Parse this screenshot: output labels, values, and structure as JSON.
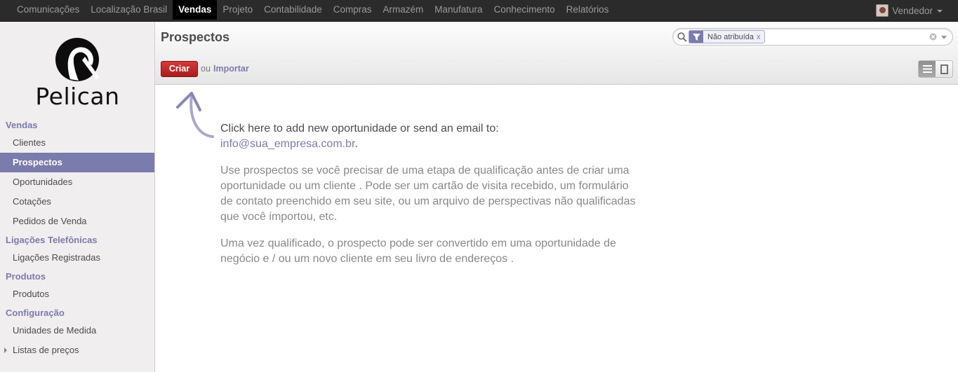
{
  "topmenu": [
    "Comunicações",
    "Localização Brasil",
    "Vendas",
    "Projeto",
    "Contabilidade",
    "Compras",
    "Armazém",
    "Manufatura",
    "Conhecimento",
    "Relatórios"
  ],
  "user": {
    "name": "Vendedor"
  },
  "logo": {
    "text": "Pelican"
  },
  "sidebar": {
    "vendas": "Vendas",
    "clientes": "Clientes",
    "prospectos": "Prospectos",
    "oportunidades": "Oportunidades",
    "cotacoes": "Cotações",
    "pedidos": "Pedidos de Venda",
    "ligacoes": "Ligações Telefônicas",
    "ligacoes_reg": "Ligações Registradas",
    "produtos_sec": "Produtos",
    "produtos": "Produtos",
    "configuracao": "Configuração",
    "unidades": "Unidades de Medida",
    "listas": "Listas de preços"
  },
  "header": {
    "title": "Prospectos",
    "criar": "Criar",
    "ou": "ou",
    "importar": "Importar",
    "facet": "Não atribuída",
    "facet_remove": "x"
  },
  "help": {
    "line1": "Click here to add new oportunidade or send an email to:",
    "email": "info@sua_empresa.com.br",
    "email_suffix": ".",
    "p2": "Use prospectos se você precisar de uma etapa de qualificação antes de criar uma oportunidade ou um cliente . Pode ser um cartão de visita recebido, um formulário de contato preenchido em seu site, ou um arquivo de perspectivas não qualificadas que você importou, etc.",
    "p3": "Uma vez qualificado, o prospecto pode ser convertido em uma oportunidade de negócio e / ou um novo cliente em seu livro de endereços ."
  },
  "colors": {
    "accent": "#7c7bad",
    "primary_button": "#b82828",
    "topbar": "#2b2b2b"
  }
}
